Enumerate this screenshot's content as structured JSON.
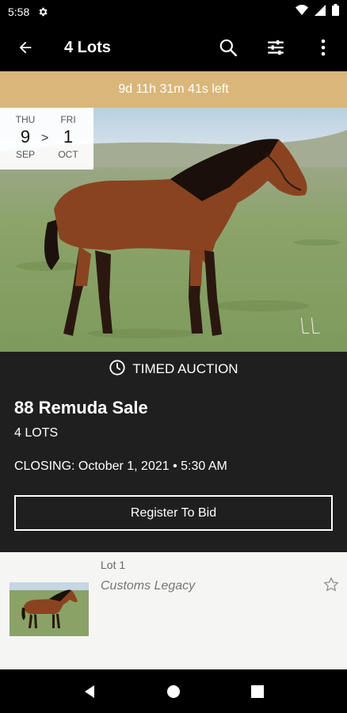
{
  "status_bar": {
    "time": "5:58",
    "icons": [
      "settings-icon",
      "wifi-icon",
      "signal-icon",
      "battery-icon"
    ]
  },
  "app_bar": {
    "title": "4 Lots",
    "icons": [
      "back-arrow-icon",
      "search-icon",
      "filter-icon",
      "more-vert-icon"
    ]
  },
  "countdown": {
    "text": "9d 11h 31m 41s left",
    "bg_color": "#d9b77a"
  },
  "date_range": {
    "start": {
      "dow": "THU",
      "day": "9",
      "month": "SEP"
    },
    "arrow": ">",
    "end": {
      "dow": "FRI",
      "day": "1",
      "month": "OCT"
    }
  },
  "auction": {
    "type_label": "TIMED AUCTION",
    "title": "88 Remuda Sale",
    "lots_count": "4 LOTS",
    "closing": "CLOSING: October 1, 2021 • 5:30 AM",
    "register_label": "Register To Bid"
  },
  "lots": [
    {
      "number": "Lot 1",
      "name": "Customs Legacy",
      "favorited": false
    }
  ],
  "nav_bar": {
    "icons": [
      "back-triangle-icon",
      "home-circle-icon",
      "recents-square-icon"
    ]
  }
}
